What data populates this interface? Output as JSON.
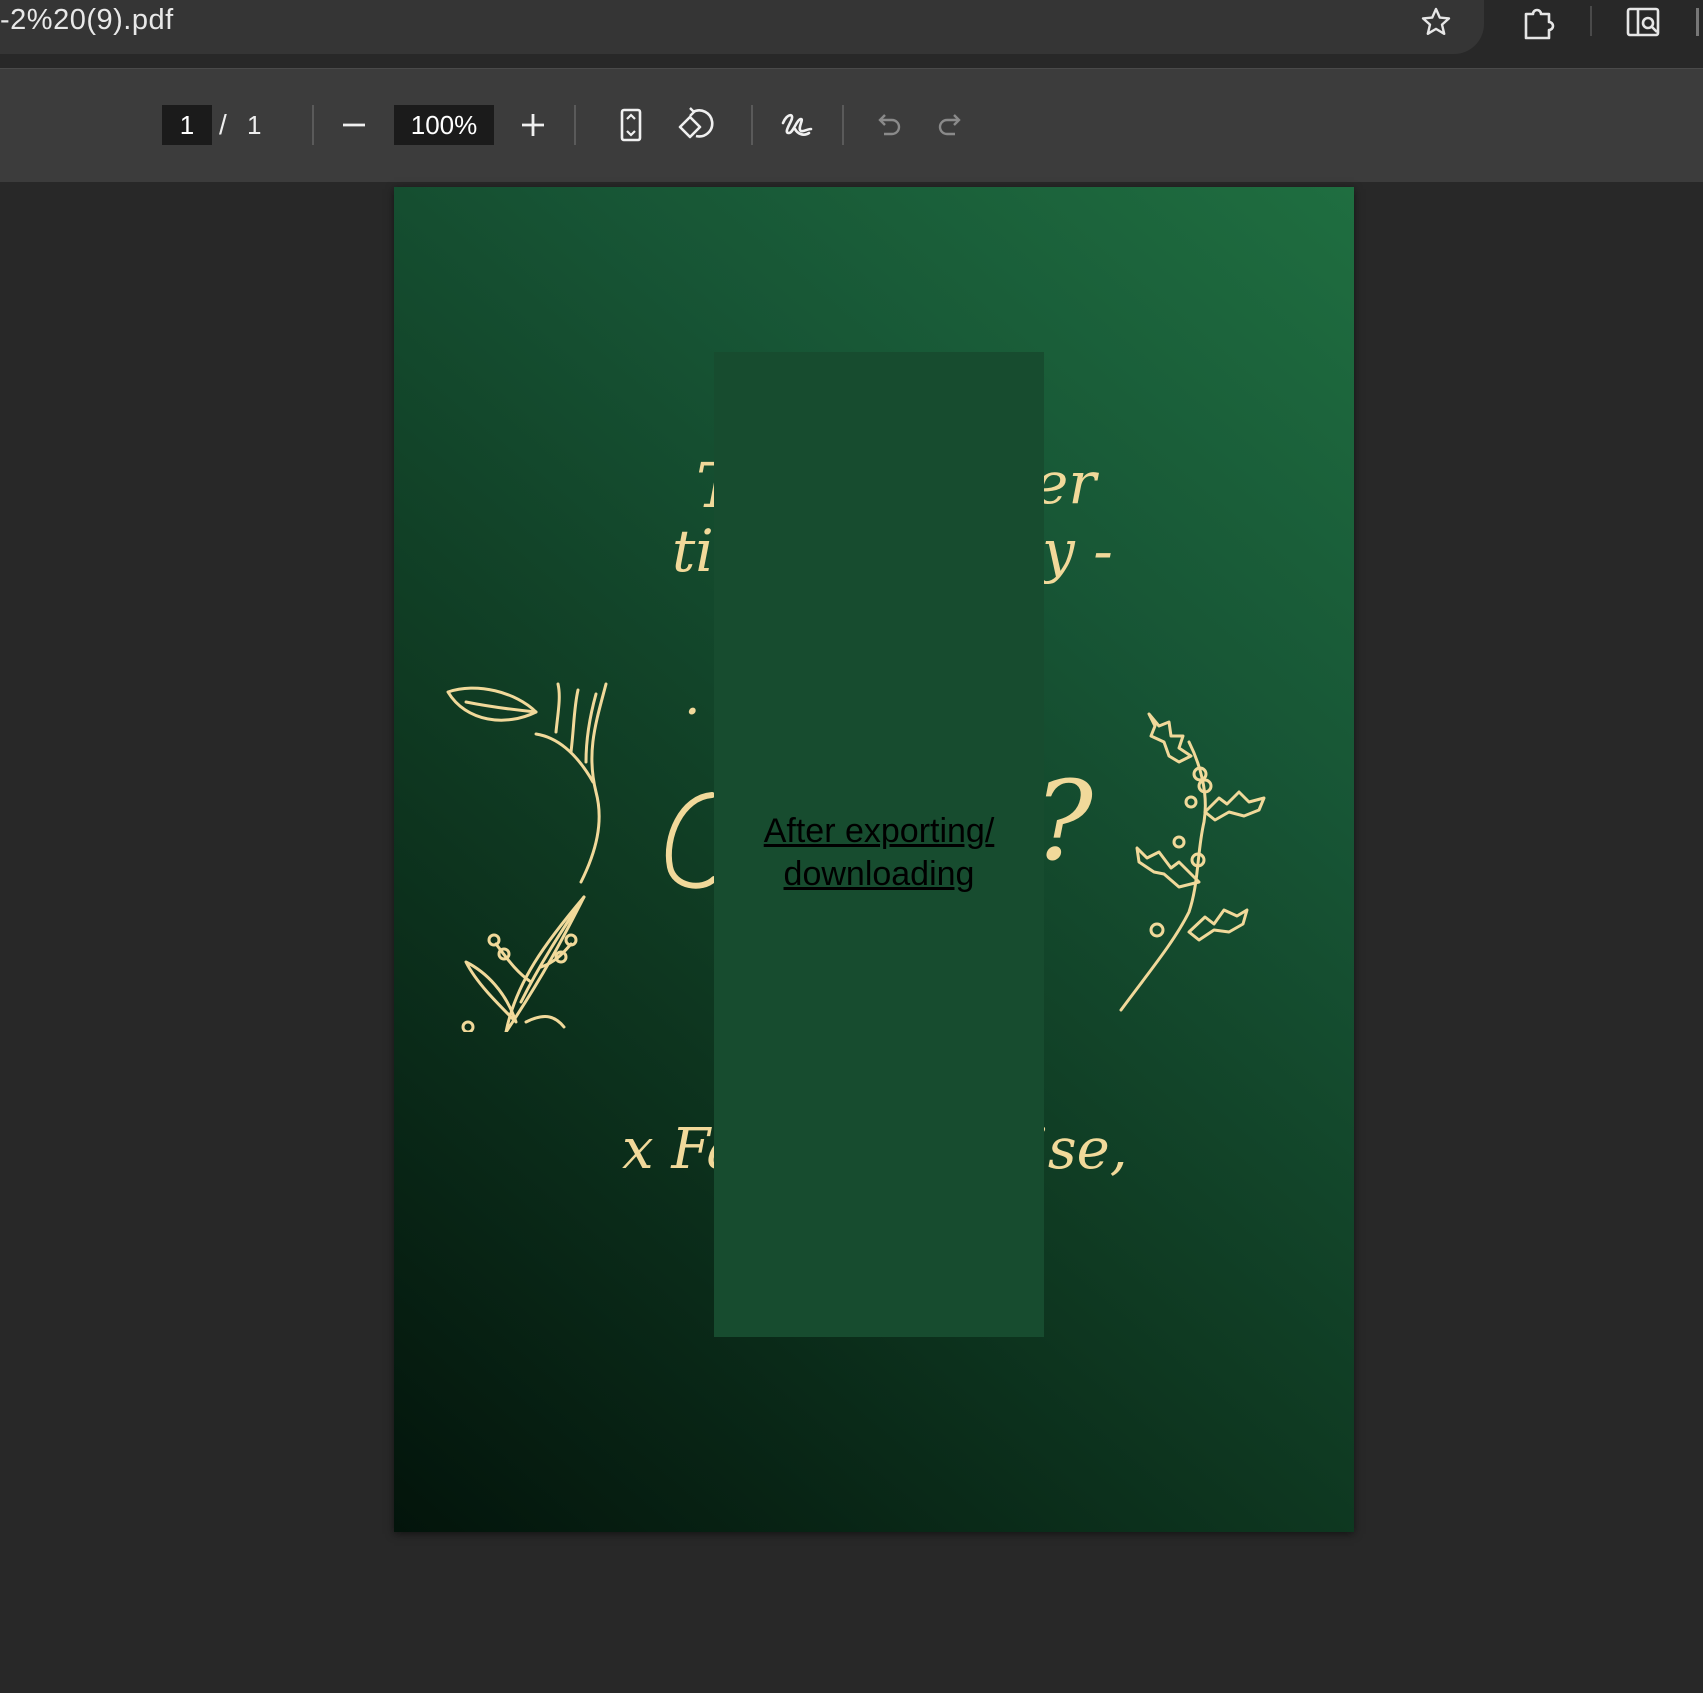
{
  "browser": {
    "url": "-2%20(9).pdf"
  },
  "toolbar": {
    "page_current": "1",
    "page_separator": "/",
    "page_total": "1",
    "zoom": "100%"
  },
  "document": {
    "line1_left": "T",
    "line1_right": "er",
    "line2_left": "ti",
    "line2_right": "y -",
    "dot_left": ".",
    "big_right": "?",
    "bottom_left": "x Fa",
    "bottom_right": "ise,",
    "overlay_link": "After exporting/ downloading"
  },
  "colors": {
    "gold": "#f1d99a",
    "overlay": "#174c2f",
    "toolbar": "#3c3c3c"
  }
}
